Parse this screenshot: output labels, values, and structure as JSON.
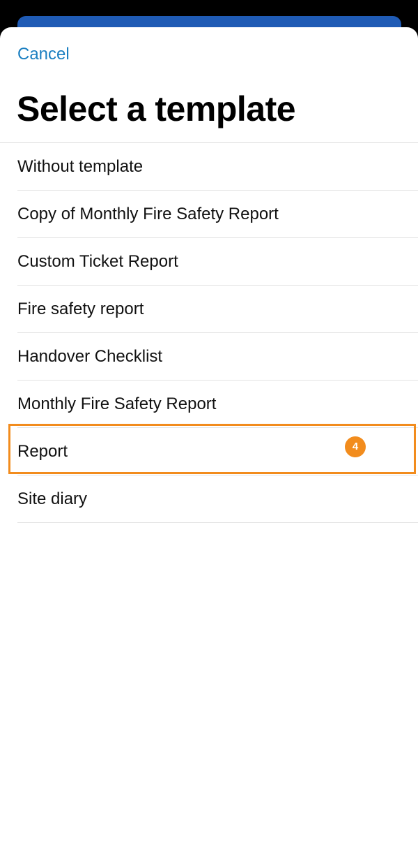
{
  "header": {
    "cancel_label": "Cancel",
    "title": "Select a template"
  },
  "templates": [
    {
      "label": "Without template"
    },
    {
      "label": "Copy of Monthly Fire Safety Report"
    },
    {
      "label": "Custom Ticket Report"
    },
    {
      "label": "Fire safety report"
    },
    {
      "label": "Handover Checklist"
    },
    {
      "label": "Monthly Fire Safety Report"
    },
    {
      "label": "Report"
    },
    {
      "label": "Site diary"
    }
  ],
  "annotation": {
    "step_number": "4",
    "highlight_color": "#f28c1d"
  },
  "colors": {
    "accent": "#1b7fc1",
    "background_card": "#1f5bb5"
  }
}
